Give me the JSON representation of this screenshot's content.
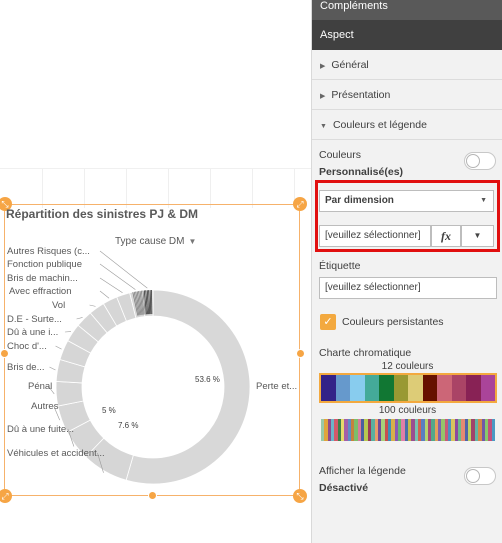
{
  "chart": {
    "title": "Répartition des sinistres PJ & DM",
    "dimension_label": "Type cause DM",
    "inner_labels": {
      "large": "53.6 %",
      "mid": "7.6 %",
      "small": "5 %"
    },
    "external_labels": [
      "Autres Risques (c...",
      "Fonction publique",
      "Bris de machin...",
      "Avec effraction",
      "Vol",
      "D.E - Surte...",
      "Dû à une i...",
      "Choc d'...",
      "Bris de...",
      "Pénal",
      "Autres",
      "Dû à une fuite...",
      "Véhicules et accident...",
      "Perte et..."
    ]
  },
  "chart_data": {
    "type": "pie",
    "title": "Répartition des sinistres PJ & DM",
    "categories": [
      "Perte et...",
      "Véhicules et accident...",
      "Dû à une fuite...",
      "Autres",
      "Pénal",
      "Bris de...",
      "Choc d'...",
      "Dû à une i...",
      "D.E - Surte...",
      "Vol",
      "Avec effraction",
      "Bris de machin...",
      "Fonction publique",
      "Autres Risques (c..."
    ],
    "values": [
      53.6,
      7.6,
      5.0,
      4.5,
      4.0,
      3.6,
      3.3,
      3.0,
      2.8,
      2.6,
      2.4,
      2.2,
      2.0,
      1.8
    ],
    "donut": true,
    "colors": [
      "#d9d9d9"
    ]
  },
  "panel": {
    "header_complements": "Compléments",
    "header_aspect": "Aspect",
    "section_general": "Général",
    "section_presentation": "Présentation",
    "section_colors_legend": "Couleurs et légende",
    "colors_label": "Couleurs",
    "colors_mode": "Personnalisé(es)",
    "color_by": "Par dimension",
    "dimension_placeholder": "[veuillez sélectionner]",
    "fx_label": "fx",
    "label_heading": "Étiquette",
    "label_placeholder": "[veuillez sélectionner]",
    "persistent_colors": "Couleurs persistantes",
    "color_scheme_label": "Charte chromatique",
    "scheme_12": "12 couleurs",
    "scheme_100": "100 couleurs",
    "show_legend": "Afficher la légende",
    "legend_state": "Désactivé"
  },
  "palette_12": [
    "#332288",
    "#6699cc",
    "#88ccee",
    "#44aa99",
    "#117733",
    "#999933",
    "#ddcc77",
    "#661100",
    "#cc6677",
    "#aa4466",
    "#882255",
    "#aa4499"
  ],
  "palette_100": [
    "#99c9a8",
    "#e0a43c",
    "#8e4a8c",
    "#6bb5c9",
    "#d4596a",
    "#3b7f4a",
    "#e6d96b",
    "#a35fa8",
    "#5d8ec5",
    "#c7823c",
    "#7cbf6a",
    "#d97b9b",
    "#4a5fa0",
    "#b8c850",
    "#9b3b58",
    "#5ab0a0",
    "#e89c6a",
    "#6e4a9a",
    "#a8d07a",
    "#c94f4f",
    "#3f8fb7",
    "#d6b04a",
    "#8a5ab4",
    "#66b870",
    "#e27fa8",
    "#4b6fa8",
    "#c8b84a",
    "#9a4f8f",
    "#78c3b0",
    "#d0654f",
    "#5a7fc0",
    "#b5d36e",
    "#a8487a",
    "#52a88a",
    "#e3a05a",
    "#7a62b0",
    "#96c46a",
    "#c85a78",
    "#4d92c0",
    "#d8c45e",
    "#8c4aa0",
    "#6cba8a",
    "#e58a72",
    "#5064a8",
    "#bfd060",
    "#a0446a",
    "#62b4a4",
    "#d6884a",
    "#7058a8",
    "#88c86a",
    "#c2507c",
    "#4a9ac4"
  ]
}
